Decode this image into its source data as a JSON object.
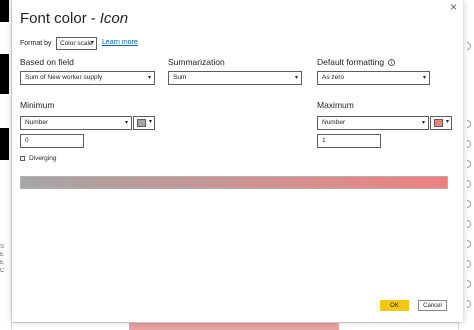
{
  "dialog": {
    "title_main": "Font color",
    "title_sep": "-",
    "title_target": "Icon",
    "close_glyph": "×"
  },
  "format_by": {
    "label": "Format by",
    "value": "Color scale",
    "learn_more": "Learn more"
  },
  "based_on_field": {
    "label": "Based on field",
    "value": "Sum of New worker supply"
  },
  "summarization": {
    "label": "Summarization",
    "value": "Sum"
  },
  "default_formatting": {
    "label": "Default formatting",
    "info_glyph": "i",
    "value": "As zero"
  },
  "minimum": {
    "label": "Minimum",
    "type": "Number",
    "value": "0",
    "color": "#a6a6a6"
  },
  "maximum": {
    "label": "Maximum",
    "type": "Number",
    "value": "1",
    "color": "#f08080"
  },
  "diverging": {
    "label": "Diverging",
    "checked": false
  },
  "buttons": {
    "ok": "OK",
    "cancel": "Cancel"
  },
  "colors": {
    "accent": "#f2c811",
    "link": "#0063b1",
    "gradient_start": "#a6a6a6",
    "gradient_end": "#f08080"
  },
  "icons": {
    "dropdown": "chevron-down-icon",
    "close": "close-icon",
    "info": "info-icon"
  },
  "background": {
    "left_marks": [
      "S",
      "E",
      "E",
      "C"
    ]
  }
}
